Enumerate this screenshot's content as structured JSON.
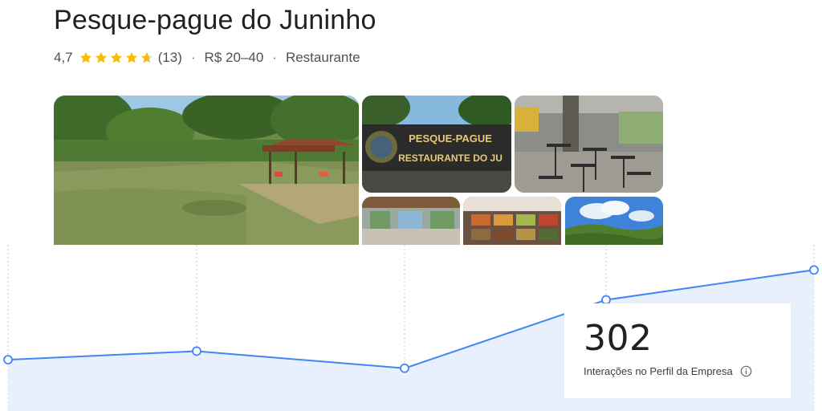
{
  "business": {
    "name": "Pesque-pague do Juninho",
    "rating": "4,7",
    "rating_value": 4.7,
    "review_count": "(13)",
    "price_range": "R$ 20–40",
    "category": "Restaurante",
    "separator": "·",
    "star_color": "#fbbc04",
    "star_empty_color": "#dadce0"
  },
  "gallery": {
    "photos": [
      {
        "name": "photo-lake-kiosk-icon"
      },
      {
        "name": "photo-restaurant-sign-icon",
        "sign_line1": "PESQUE-PAGUE",
        "sign_line2": "RESTAURANTE DO JU"
      },
      {
        "name": "photo-dining-terrace-icon"
      },
      {
        "name": "photo-interior-icon"
      },
      {
        "name": "photo-buffet-icon"
      },
      {
        "name": "photo-sky-trees-icon"
      }
    ]
  },
  "stat": {
    "value": "302",
    "label": "Interações no Perfil da Empresa",
    "info_icon": "info-icon"
  },
  "chart_data": {
    "type": "area",
    "series": [
      {
        "values": [
          302,
          304,
          300,
          316,
          323
        ]
      }
    ],
    "line_color": "#4285f4",
    "fill_color": "#e8f0fe",
    "grid": "vertical-dotted"
  }
}
